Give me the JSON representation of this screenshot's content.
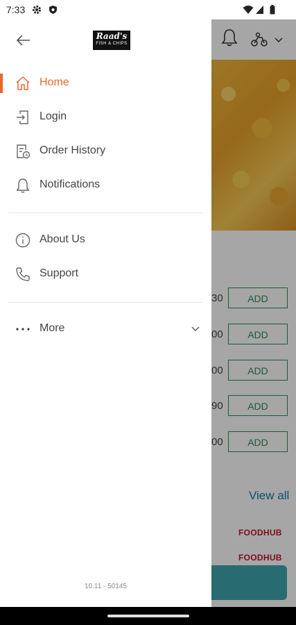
{
  "status_bar": {
    "time": "7:33",
    "icons": [
      "settings-icon",
      "shield-icon",
      "wifi-icon",
      "signal-icon",
      "battery-icon"
    ]
  },
  "drawer": {
    "logo": {
      "text": "Raad's",
      "subtext": "FISH & CHIPS"
    },
    "menu_primary": [
      {
        "label": "Home",
        "icon": "home-icon",
        "active": true
      },
      {
        "label": "Login",
        "icon": "login-icon"
      },
      {
        "label": "Order History",
        "icon": "order-history-icon"
      },
      {
        "label": "Notifications",
        "icon": "bell-icon"
      }
    ],
    "menu_secondary": [
      {
        "label": "About Us",
        "icon": "info-icon"
      },
      {
        "label": "Support",
        "icon": "phone-icon"
      }
    ],
    "more": {
      "label": "More",
      "icon": "more-dots-icon"
    },
    "version": "10.11 - 50145"
  },
  "background": {
    "price_fragments": [
      "30",
      "00",
      "00",
      "90",
      "00"
    ],
    "add_label": "ADD",
    "view_all": "View all",
    "brands": [
      "FOODHUB",
      "FOODHUB"
    ]
  },
  "colors": {
    "accent": "#e8692c",
    "add_green": "#2e8b57",
    "link_blue": "#1a7b9d",
    "cta": "#3ea7b0"
  }
}
